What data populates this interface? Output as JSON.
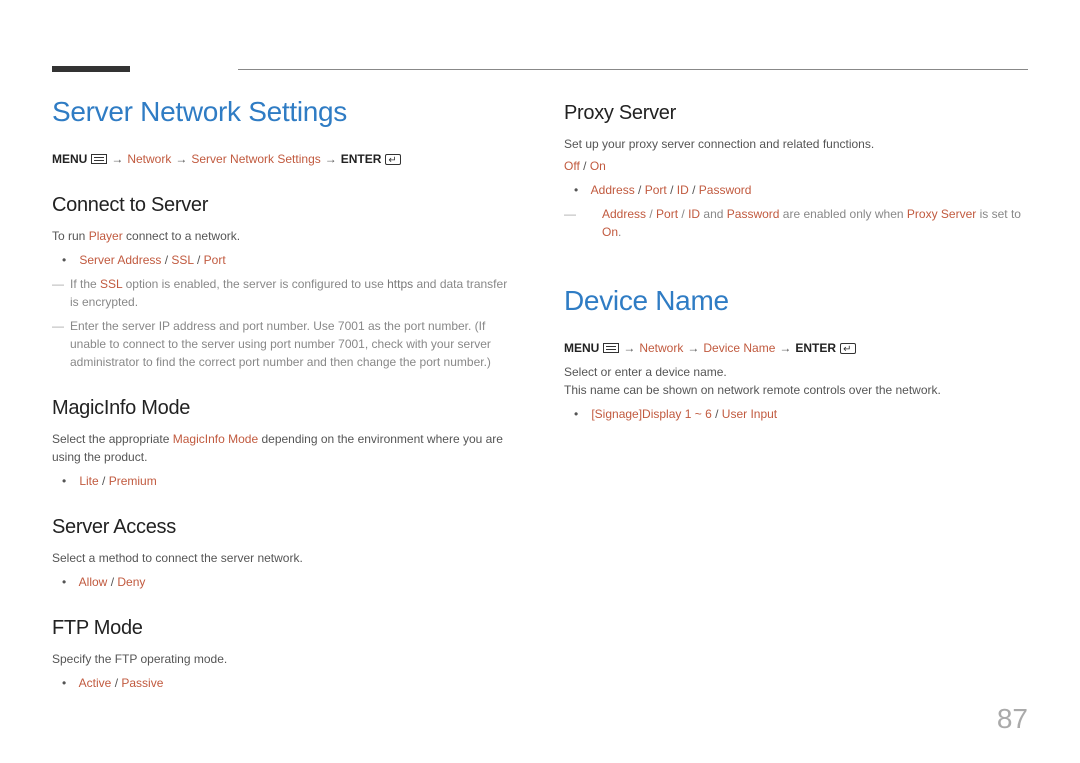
{
  "page_number": "87",
  "path_labels": {
    "menu": "MENU",
    "enter": "ENTER",
    "arrow": "→"
  },
  "left": {
    "h1": "Server Network Settings",
    "path": {
      "p1": "Network",
      "p2": "Server Network Settings"
    },
    "connect": {
      "title": "Connect to Server",
      "run_prefix": "To run ",
      "player": "Player",
      "run_suffix": " connect to a network.",
      "opt_serveraddr": "Server Address",
      "opt_ssl": "SSL",
      "opt_port": "Port",
      "note1_a": "If the ",
      "note1_b": "SSL",
      "note1_c": " option is enabled, the server is configured to use ",
      "note1_d": "https",
      "note1_e": " and data transfer is encrypted.",
      "note2": "Enter the server IP address and port number. Use 7001 as the port number. (If unable to connect to the server using port number 7001, check with your server administrator to find the correct port number and then change the port number.)"
    },
    "magic": {
      "title": "MagicInfo Mode",
      "desc_a": "Select the appropriate ",
      "desc_b": "MagicInfo Mode",
      "desc_c": " depending on the environment where you are using the product.",
      "opt_lite": "Lite",
      "opt_premium": "Premium"
    },
    "access": {
      "title": "Server Access",
      "desc": "Select a method to connect the server network.",
      "opt_allow": "Allow",
      "opt_deny": "Deny"
    },
    "ftp": {
      "title": "FTP Mode",
      "desc": "Specify the FTP operating mode.",
      "opt_active": "Active",
      "opt_passive": "Passive"
    }
  },
  "right": {
    "proxy": {
      "title": "Proxy Server",
      "desc": "Set up your proxy server connection and related functions.",
      "opt_off": "Off",
      "opt_on": "On",
      "opt_address": "Address",
      "opt_port": "Port",
      "opt_id": "ID",
      "opt_password": "Password",
      "note_a": "Address",
      "note_b": "Port",
      "note_c": "ID",
      "note_and": " and ",
      "note_d": "Password",
      "note_e": " are enabled only when ",
      "note_f": "Proxy Server",
      "note_g": " is set to ",
      "note_h": "On",
      "note_i": "."
    },
    "device": {
      "h1": "Device Name",
      "path": {
        "p1": "Network",
        "p2": "Device Name"
      },
      "desc1": "Select or enter a device name.",
      "desc2": "This name can be shown on network remote controls over the network.",
      "opt_range": "[Signage]Display 1 ~ 6",
      "opt_user": "User Input"
    }
  },
  "sep": " / "
}
